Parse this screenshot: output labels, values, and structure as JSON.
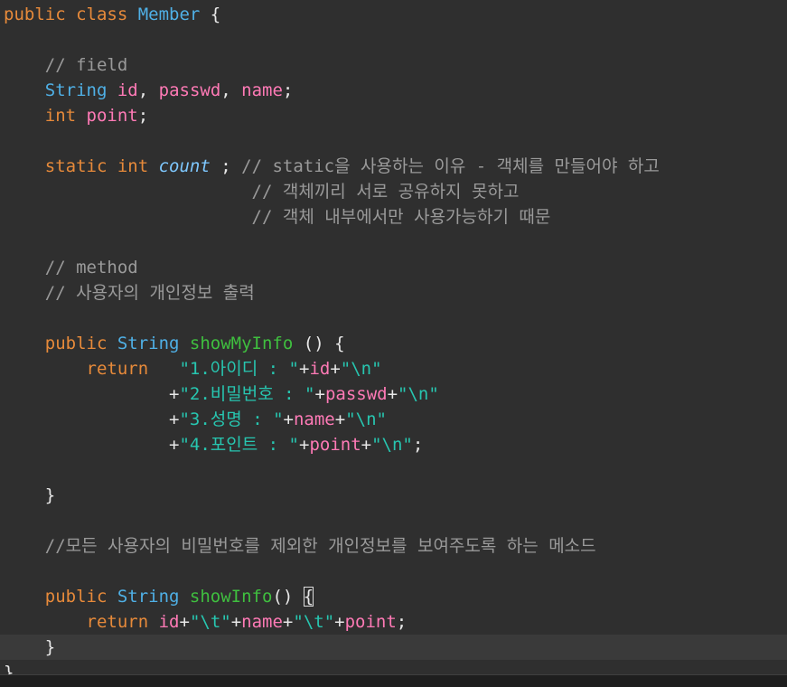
{
  "editor": {
    "colors": {
      "background": "#2f2f2f",
      "keyword": "#e78a3a",
      "type": "#4fb0e6",
      "variable": "#ff7ab6",
      "static_field": "#7ec8ff",
      "method": "#3fbf3f",
      "string": "#27c6b0",
      "comment": "#9a9a9a"
    },
    "current_line_index": 25,
    "lines": [
      [
        [
          "kw",
          "public "
        ],
        [
          "kw",
          "class "
        ],
        [
          "type",
          "Member "
        ],
        [
          "plain",
          "{"
        ]
      ],
      [],
      [
        [
          "plain",
          "    "
        ],
        [
          "comment",
          "// field"
        ]
      ],
      [
        [
          "plain",
          "    "
        ],
        [
          "type",
          "String "
        ],
        [
          "var",
          "id"
        ],
        [
          "plain",
          ", "
        ],
        [
          "var",
          "passwd"
        ],
        [
          "plain",
          ", "
        ],
        [
          "var",
          "name"
        ],
        [
          "plain",
          ";"
        ]
      ],
      [
        [
          "plain",
          "    "
        ],
        [
          "kw",
          "int "
        ],
        [
          "var",
          "point"
        ],
        [
          "plain",
          ";"
        ]
      ],
      [],
      [
        [
          "plain",
          "    "
        ],
        [
          "kw",
          "static "
        ],
        [
          "kw",
          "int "
        ],
        [
          "italic",
          "count"
        ],
        [
          "plain",
          " ; "
        ],
        [
          "comment",
          "// static을 사용하는 이유 - 객체를 만들어야 하고"
        ]
      ],
      [
        [
          "plain",
          "                        "
        ],
        [
          "comment",
          "// 객체끼리 서로 공유하지 못하고"
        ]
      ],
      [
        [
          "plain",
          "                        "
        ],
        [
          "comment",
          "// 객체 내부에서만 사용가능하기 때문"
        ]
      ],
      [],
      [
        [
          "plain",
          "    "
        ],
        [
          "comment",
          "// method"
        ]
      ],
      [
        [
          "plain",
          "    "
        ],
        [
          "comment",
          "// 사용자의 개인정보 출력"
        ]
      ],
      [],
      [
        [
          "plain",
          "    "
        ],
        [
          "kw",
          "public "
        ],
        [
          "type",
          "String "
        ],
        [
          "method",
          "showMyInfo"
        ],
        [
          "plain",
          " () {"
        ]
      ],
      [
        [
          "plain",
          "        "
        ],
        [
          "kw",
          "return"
        ],
        [
          "plain",
          "   "
        ],
        [
          "str",
          "\"1.아이디 : \""
        ],
        [
          "plain",
          "+"
        ],
        [
          "var",
          "id"
        ],
        [
          "plain",
          "+"
        ],
        [
          "str",
          "\"\\n\""
        ]
      ],
      [
        [
          "plain",
          "                "
        ],
        [
          "plain",
          "+"
        ],
        [
          "str",
          "\"2.비밀번호 : \""
        ],
        [
          "plain",
          "+"
        ],
        [
          "var",
          "passwd"
        ],
        [
          "plain",
          "+"
        ],
        [
          "str",
          "\"\\n\""
        ]
      ],
      [
        [
          "plain",
          "                "
        ],
        [
          "plain",
          "+"
        ],
        [
          "str",
          "\"3.성명 : \""
        ],
        [
          "plain",
          "+"
        ],
        [
          "var",
          "name"
        ],
        [
          "plain",
          "+"
        ],
        [
          "str",
          "\"\\n\""
        ]
      ],
      [
        [
          "plain",
          "                "
        ],
        [
          "plain",
          "+"
        ],
        [
          "str",
          "\"4.포인트 : \""
        ],
        [
          "plain",
          "+"
        ],
        [
          "var",
          "point"
        ],
        [
          "plain",
          "+"
        ],
        [
          "str",
          "\"\\n\""
        ],
        [
          "plain",
          ";"
        ]
      ],
      [],
      [
        [
          "plain",
          "    }"
        ]
      ],
      [],
      [
        [
          "plain",
          "    "
        ],
        [
          "comment",
          "//모든 사용자의 비밀번호를 제외한 개인정보를 보여주도록 하는 메소드"
        ]
      ],
      [],
      [
        [
          "plain",
          "    "
        ],
        [
          "kw",
          "public "
        ],
        [
          "type",
          "String "
        ],
        [
          "method",
          "showInfo"
        ],
        [
          "plain",
          "() "
        ],
        [
          "brace-hl",
          "{"
        ]
      ],
      [
        [
          "plain",
          "        "
        ],
        [
          "kw",
          "return "
        ],
        [
          "var",
          "id"
        ],
        [
          "plain",
          "+"
        ],
        [
          "str",
          "\"\\t\""
        ],
        [
          "plain",
          "+"
        ],
        [
          "var",
          "name"
        ],
        [
          "plain",
          "+"
        ],
        [
          "str",
          "\"\\t\""
        ],
        [
          "plain",
          "+"
        ],
        [
          "var",
          "point"
        ],
        [
          "plain",
          ";"
        ]
      ],
      [
        [
          "plain",
          "    }"
        ]
      ],
      [
        [
          "plain",
          "}"
        ]
      ]
    ]
  }
}
